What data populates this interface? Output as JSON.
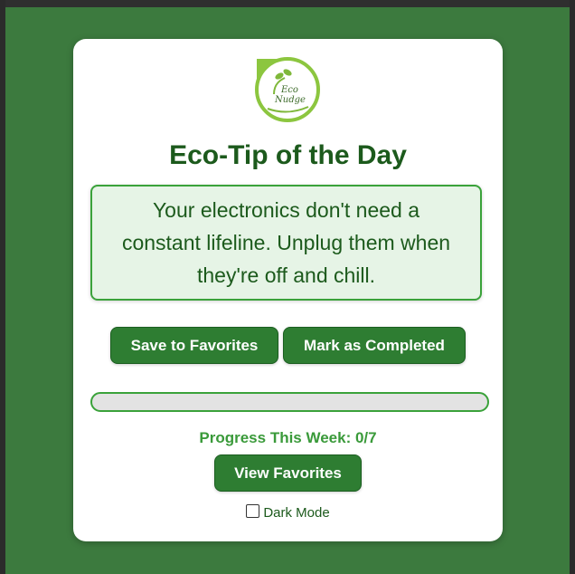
{
  "app": {
    "logo_text_line1": "Eco",
    "logo_text_line2": "Nudge"
  },
  "card": {
    "title": "Eco-Tip of the Day",
    "tip": "Your electronics don't need a constant lifeline. Unplug them when they're off and chill."
  },
  "actions": {
    "save_label": "Save to Favorites",
    "complete_label": "Mark as Completed",
    "view_label": "View Favorites"
  },
  "progress": {
    "label": "Progress This Week: 0/7",
    "completed": 0,
    "total": 7,
    "fraction": 0
  },
  "settings": {
    "dark_mode_label": "Dark Mode",
    "dark_mode_checked": false
  },
  "colors": {
    "background": "#3c7a3e",
    "accent": "#2e7d32",
    "title": "#1c5a1c",
    "progress_border": "#3aa23a",
    "tip_bg": "#e6f4e6"
  }
}
